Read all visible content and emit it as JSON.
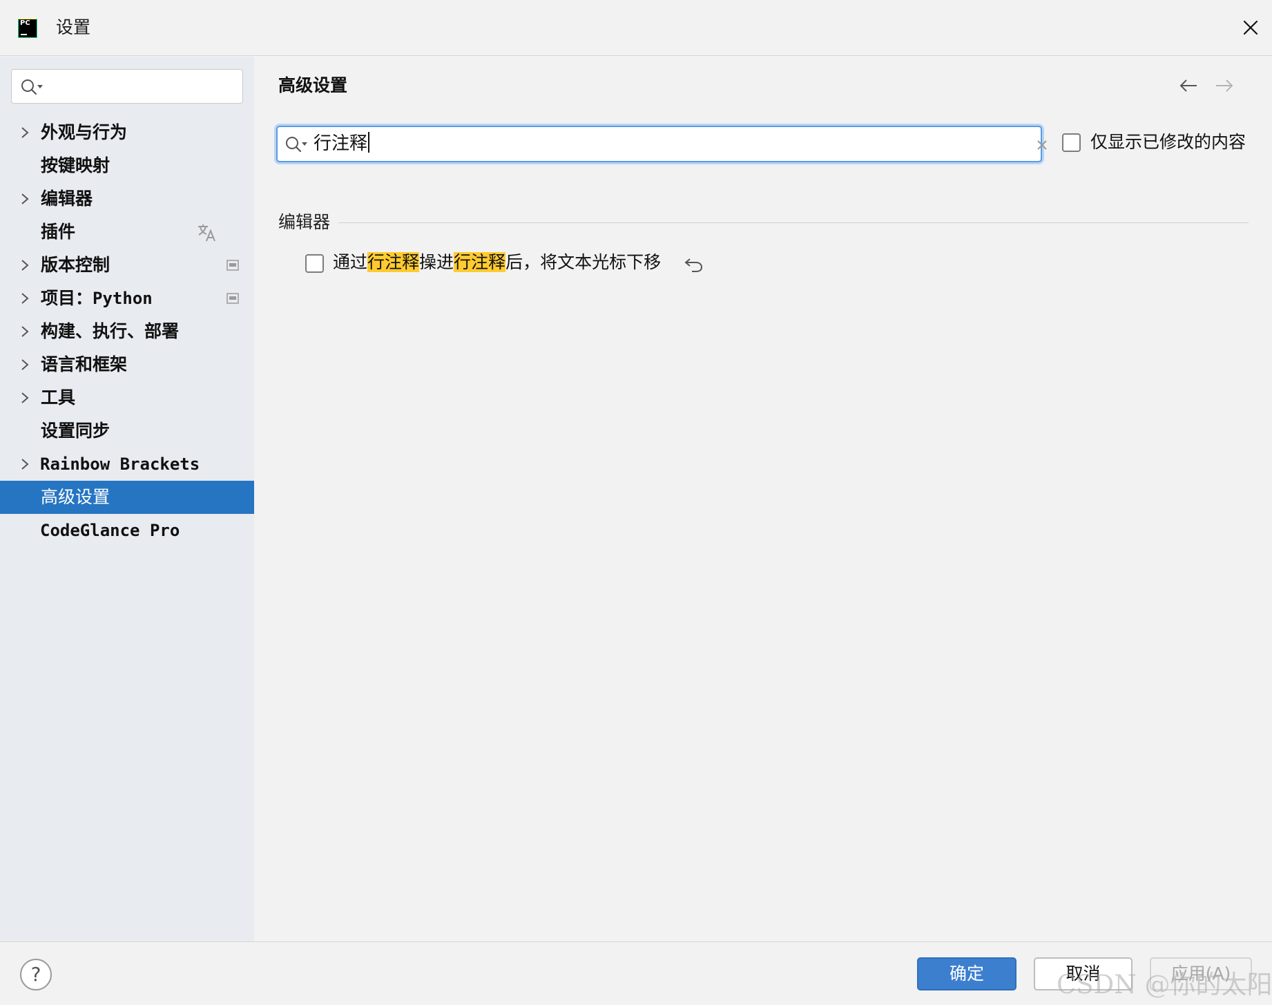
{
  "window": {
    "title": "设置",
    "app_icon": "pycharm-logo",
    "app_icon_text": "PC"
  },
  "sidebar": {
    "search": {
      "value": "",
      "placeholder": ""
    },
    "items": [
      {
        "label": "外观与行为",
        "expandable": true
      },
      {
        "label": "按键映射",
        "expandable": false
      },
      {
        "label": "编辑器",
        "expandable": true
      },
      {
        "label": "插件",
        "expandable": false,
        "side_icon": "translate-icon"
      },
      {
        "label": "版本控制",
        "expandable": true,
        "side_icon": "project-scope-icon"
      },
      {
        "label": "项目：",
        "label_mono": "Python",
        "expandable": true,
        "side_icon": "project-scope-icon"
      },
      {
        "label": "构建、执行、部署",
        "expandable": true
      },
      {
        "label": "语言和框架",
        "expandable": true
      },
      {
        "label": "工具",
        "expandable": true
      },
      {
        "label": "设置同步",
        "expandable": false
      },
      {
        "label": "Rainbow Brackets",
        "expandable": true
      },
      {
        "label": "高级设置",
        "expandable": false,
        "selected": true
      },
      {
        "label": "CodeGlance Pro",
        "expandable": false
      }
    ]
  },
  "main": {
    "page_title": "高级设置",
    "search": {
      "value": "行注释",
      "placeholder": ""
    },
    "modified_only_label": "仅显示已修改的内容",
    "section_title": "编辑器",
    "option": {
      "text_parts": [
        "通过",
        "行注释",
        "操进",
        "行注释",
        "后，将文本光标下移"
      ],
      "checked": false
    }
  },
  "footer": {
    "help_label": "?",
    "ok_label": "确定",
    "cancel_label": "取消",
    "apply_label": "应用(A)"
  },
  "watermark": "CSDN @你的太阳",
  "colors": {
    "selection": "#2675c2",
    "highlight": "#ffcb30",
    "primary_button": "#3d7fcf",
    "sidebar_bg": "#e8ebf0"
  }
}
